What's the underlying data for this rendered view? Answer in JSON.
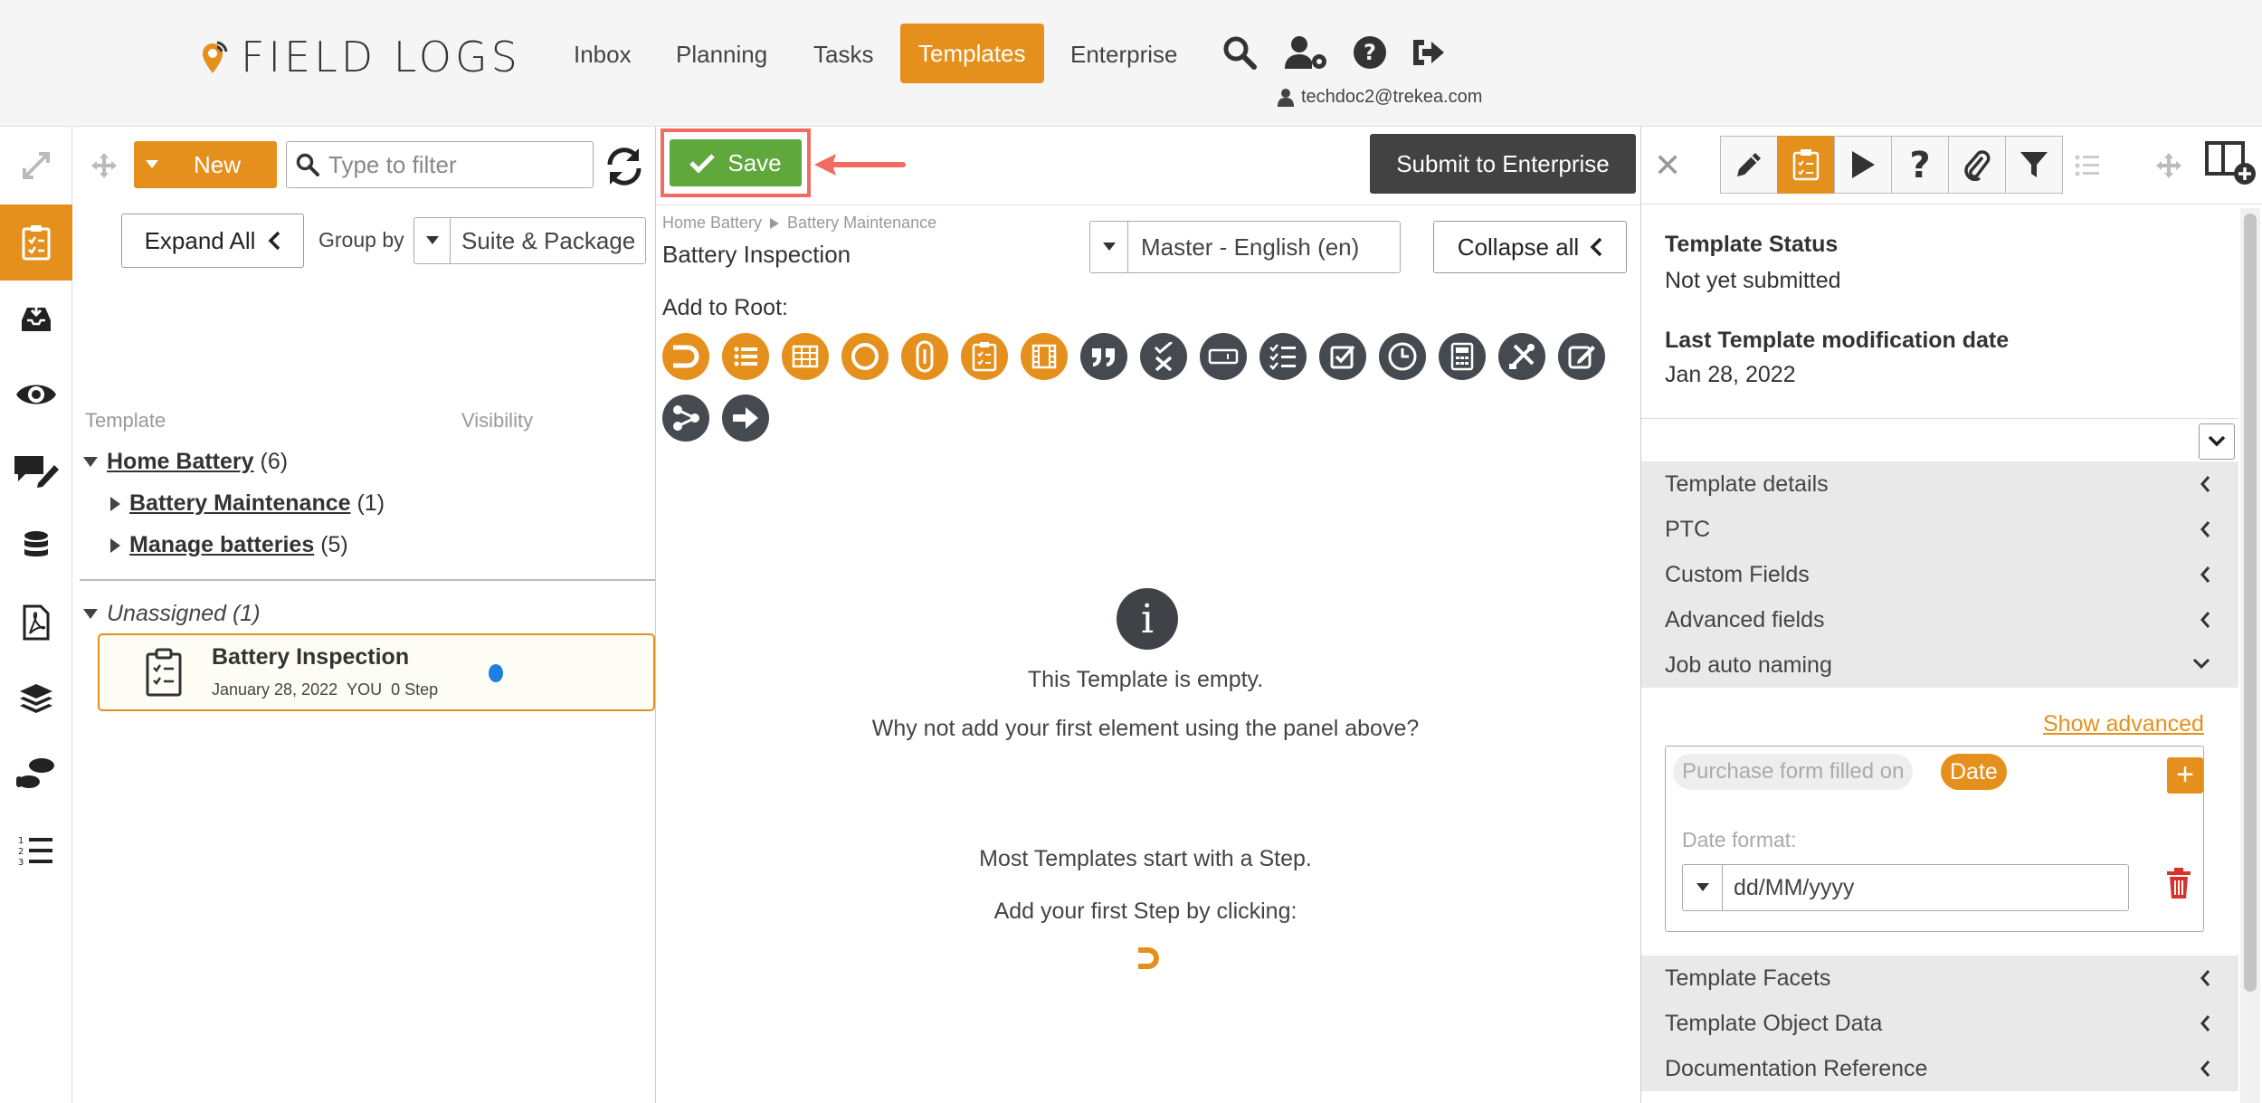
{
  "brand": {
    "logo_text": "FIELD LOGS",
    "accent": "#e5901c",
    "save_green": "#5fa83c"
  },
  "nav": {
    "items": [
      {
        "label": "Inbox"
      },
      {
        "label": "Planning"
      },
      {
        "label": "Tasks"
      },
      {
        "label": "Templates",
        "active": true
      },
      {
        "label": "Enterprise"
      }
    ],
    "icons": [
      "search-icon",
      "user-settings-icon",
      "help-icon",
      "logout-icon"
    ],
    "user_email": "techdoc2@trekea.com"
  },
  "rail": {
    "icons": [
      "expand-arrows-icon",
      "templates-icon",
      "inbox-tray-icon",
      "eye-icon",
      "comment-edit-icon",
      "database-icon",
      "pdf-file-icon",
      "layers-icon",
      "footsteps-icon",
      "numbered-list-icon"
    ]
  },
  "tree": {
    "new_label": "New",
    "filter_placeholder": "Type to filter",
    "expand_all_label": "Expand All",
    "group_by_label": "Group by",
    "group_by_value": "Suite & Package",
    "col_template": "Template",
    "col_visibility": "Visibility",
    "nodes": [
      {
        "name": "Home Battery",
        "count": "(6)"
      },
      {
        "name": "Battery Maintenance",
        "count": "(1)"
      },
      {
        "name": "Manage batteries",
        "count": "(5)"
      }
    ],
    "unassigned_label": "Unassigned (1)",
    "card": {
      "title": "Battery Inspection",
      "date": "January 28, 2022",
      "owner": "YOU",
      "steps": "0 Step"
    }
  },
  "center": {
    "save_label": "Save",
    "submit_label": "Submit to Enterprise",
    "breadcrumb": [
      "Home Battery",
      "Battery Maintenance"
    ],
    "title": "Battery Inspection",
    "language": "Master - English (en)",
    "collapse_all_label": "Collapse all",
    "add_to_root_label": "Add to Root:",
    "element_icons": [
      "step-icon",
      "list-icon",
      "table-icon",
      "circle-icon",
      "attachment-icon",
      "checklist-icon",
      "film-icon",
      "quote-icon",
      "close-check-icon",
      "input-field-icon",
      "check-list-icon",
      "checkbox-icon",
      "clock-icon",
      "calculator-icon",
      "tools-icon",
      "edit-note-icon",
      "share-icon",
      "arrow-right-icon"
    ],
    "empty": {
      "line1": "This Template is empty.",
      "line2": "Why not add your first element using the panel above?",
      "line3": "Most Templates start with a Step.",
      "line4": "Add your first Step by clicking:"
    }
  },
  "right": {
    "tool_icons": [
      "pencil-icon",
      "clipboard-icon",
      "play-icon",
      "question-icon",
      "paperclip-icon",
      "filter-icon",
      "list-icon",
      "move-icon",
      "add-panel-icon"
    ],
    "status_title": "Template Status",
    "status_value": "Not yet submitted",
    "mod_title": "Last Template modification date",
    "mod_value": "Jan 28, 2022",
    "sections_top": [
      "Template details",
      "PTC",
      "Custom Fields",
      "Advanced fields",
      "Job auto naming"
    ],
    "show_advanced": "Show advanced",
    "naming": {
      "pill_text": "Purchase form filled on",
      "date_pill": "Date",
      "date_format_label": "Date format:",
      "date_format_value": "dd/MM/yyyy"
    },
    "sections_bottom": [
      "Template Facets",
      "Template Object Data",
      "Documentation Reference"
    ]
  }
}
